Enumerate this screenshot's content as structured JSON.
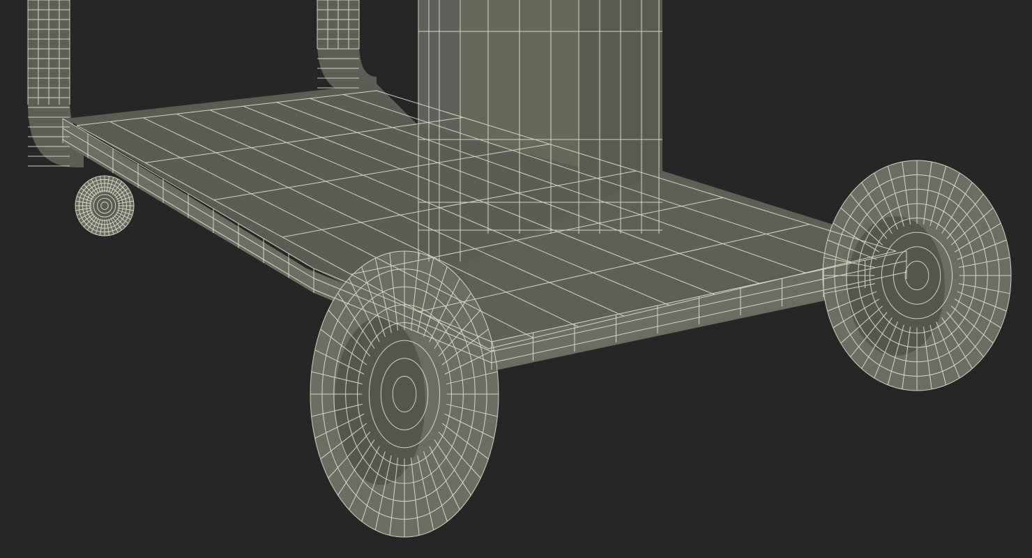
{
  "scene": {
    "subject": "cart",
    "render_style": "wireframe",
    "colors": {
      "background": "#262626",
      "surface": "#5d5e55",
      "surface_dark": "#4a4b44",
      "surface_light": "#727366",
      "wire": "#ecebd8"
    },
    "mesh": {
      "tray_grid_rows": 6,
      "tray_grid_cols": 9,
      "wheel_rings": 8,
      "wheel_segments": 40
    }
  }
}
